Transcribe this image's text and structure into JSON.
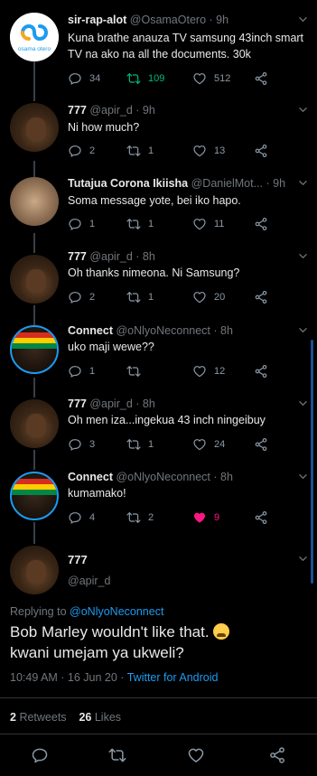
{
  "tweets": [
    {
      "name": "sir-rap-alot",
      "handle": "@OsamaOtero",
      "time": "· 9h",
      "text": "Kuna brathe anauza TV samsung 43inch smart TV na ako na all the documents. 30k",
      "replies": "34",
      "retweets": "109",
      "likes": "512",
      "avatar_label": "osama otero"
    },
    {
      "name": "777",
      "handle": "@apir_d",
      "time": "· 9h",
      "text": "Ni how much?",
      "replies": "2",
      "retweets": "1",
      "likes": "13"
    },
    {
      "name": "Tutajua Corona Ikiisha",
      "handle": "@DanielMot...",
      "time": "· 9h",
      "text": "Soma message yote, bei iko hapo.",
      "replies": "1",
      "retweets": "1",
      "likes": "11"
    },
    {
      "name": "777",
      "handle": "@apir_d",
      "time": "· 8h",
      "text": "Oh thanks nimeona. Ni Samsung?",
      "replies": "2",
      "retweets": "1",
      "likes": "20"
    },
    {
      "name": "Connect",
      "handle": "@oNlyoNeconnect",
      "time": "· 8h",
      "text": "uko maji wewe??",
      "replies": "1",
      "retweets": "",
      "likes": "12"
    },
    {
      "name": "777",
      "handle": "@apir_d",
      "time": "· 8h",
      "text": "Oh men iza...ingekua 43 inch ningeibuy",
      "replies": "3",
      "retweets": "1",
      "likes": "24"
    },
    {
      "name": "Connect",
      "handle": "@oNlyoNeconnect",
      "time": "· 8h",
      "text": "kumamako!",
      "replies": "4",
      "retweets": "2",
      "likes": "9"
    }
  ],
  "focus": {
    "name": "777",
    "handle": "@apir_d",
    "replying_prefix": "Replying to",
    "replying_to": "@oNlyoNeconnect",
    "text": "Bob Marley wouldn't like that.",
    "text2": "kwani umejam ya ukweli?",
    "time": "10:49 AM · 16 Jun 20 ·",
    "source": "Twitter for Android",
    "retweets_count": "2",
    "retweets_label": "Retweets",
    "likes_count": "26",
    "likes_label": "Likes"
  },
  "colors": {
    "background": "#000000",
    "retweet_active": "#00ba7c",
    "like_active": "#f91880",
    "link": "#1d9bf0"
  },
  "icons": [
    "reply-icon",
    "retweet-icon",
    "like-icon",
    "share-icon",
    "chevron-down-icon",
    "loudly-crying-emoji"
  ]
}
